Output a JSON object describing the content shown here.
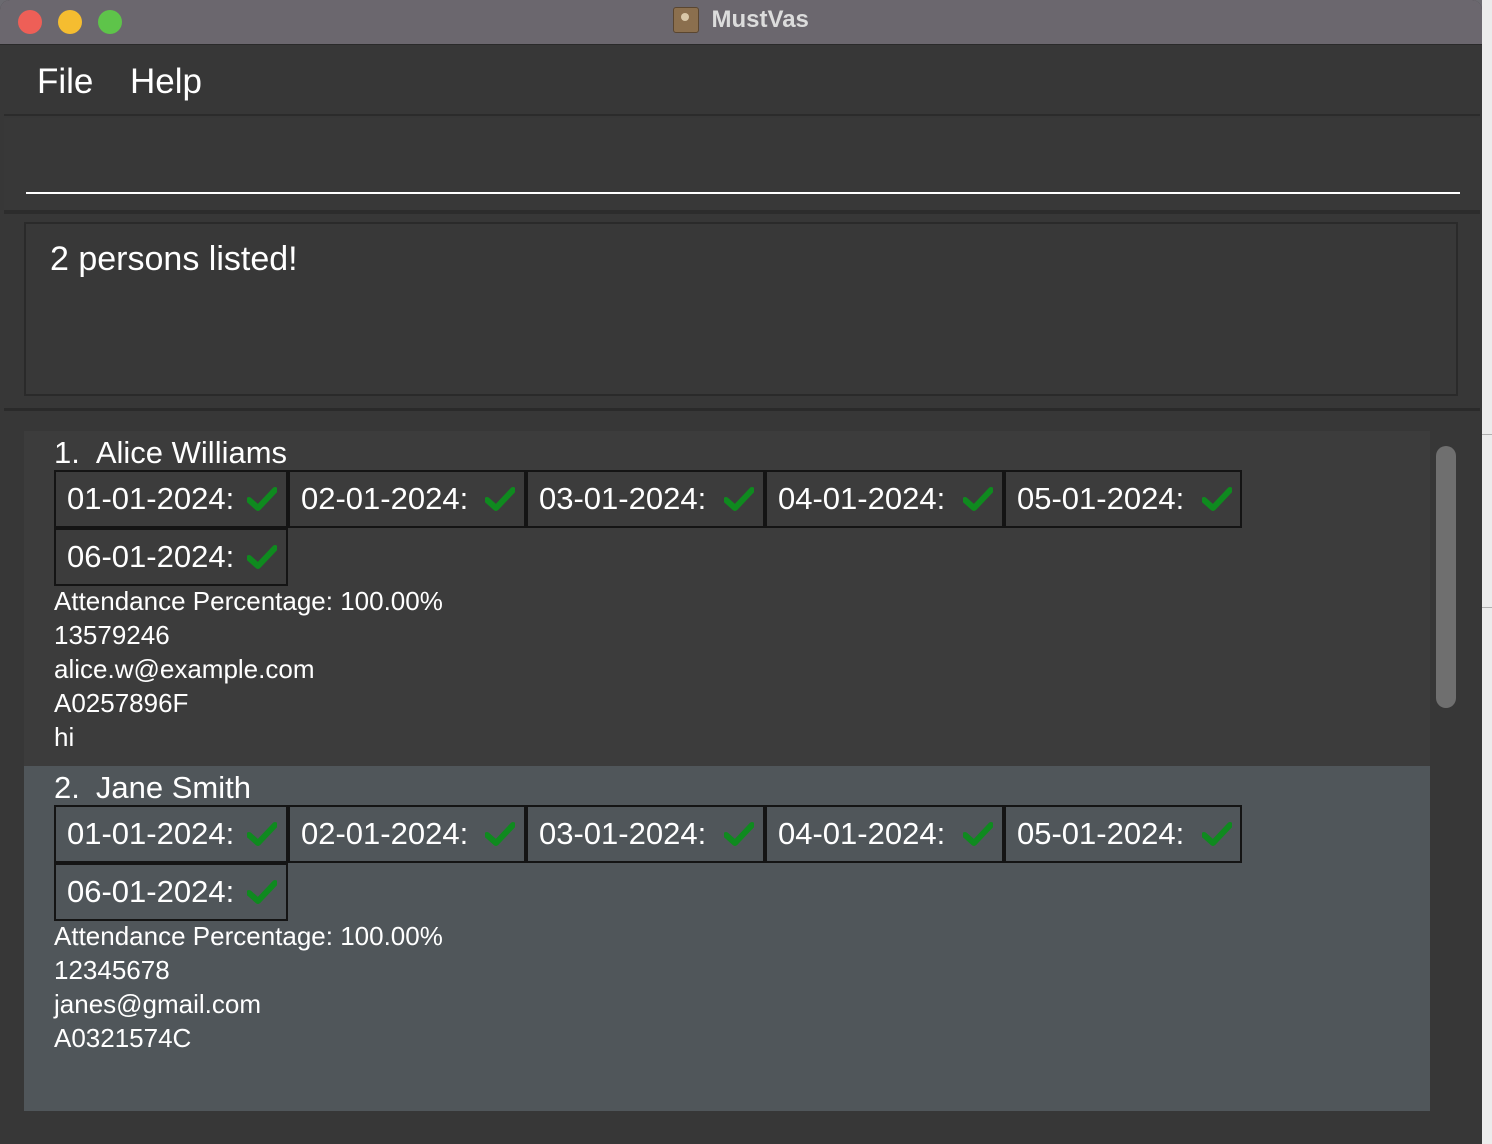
{
  "window": {
    "title": "MustVas"
  },
  "menu": {
    "items": [
      "File",
      "Help"
    ]
  },
  "command": {
    "value": "",
    "placeholder": ""
  },
  "result": {
    "message": "2 persons listed!"
  },
  "persons": [
    {
      "index": "1.",
      "name": "Alice Williams",
      "attendance": [
        {
          "date": "01-01-2024:",
          "status": "present"
        },
        {
          "date": "02-01-2024:",
          "status": "present"
        },
        {
          "date": "03-01-2024:",
          "status": "present"
        },
        {
          "date": "04-01-2024:",
          "status": "present"
        },
        {
          "date": "05-01-2024:",
          "status": "present"
        },
        {
          "date": "06-01-2024:",
          "status": "present"
        }
      ],
      "attendance_percentage": "Attendance Percentage: 100.00%",
      "phone": "13579246",
      "email": "alice.w@example.com",
      "student_id": "A0257896F",
      "remark": "hi"
    },
    {
      "index": "2.",
      "name": "Jane Smith",
      "attendance": [
        {
          "date": "01-01-2024:",
          "status": "present"
        },
        {
          "date": "02-01-2024:",
          "status": "present"
        },
        {
          "date": "03-01-2024:",
          "status": "present"
        },
        {
          "date": "04-01-2024:",
          "status": "present"
        },
        {
          "date": "05-01-2024:",
          "status": "present"
        },
        {
          "date": "06-01-2024:",
          "status": "present"
        }
      ],
      "attendance_percentage": "Attendance Percentage: 100.00%",
      "phone": "12345678",
      "email": "janes@gmail.com",
      "student_id": "A0321574C",
      "remark": ""
    }
  ],
  "colors": {
    "check": "#0f8a1f",
    "selected_card": "#50565a",
    "window_bg": "#373737"
  },
  "icons": {
    "present": "checkmark-icon"
  }
}
